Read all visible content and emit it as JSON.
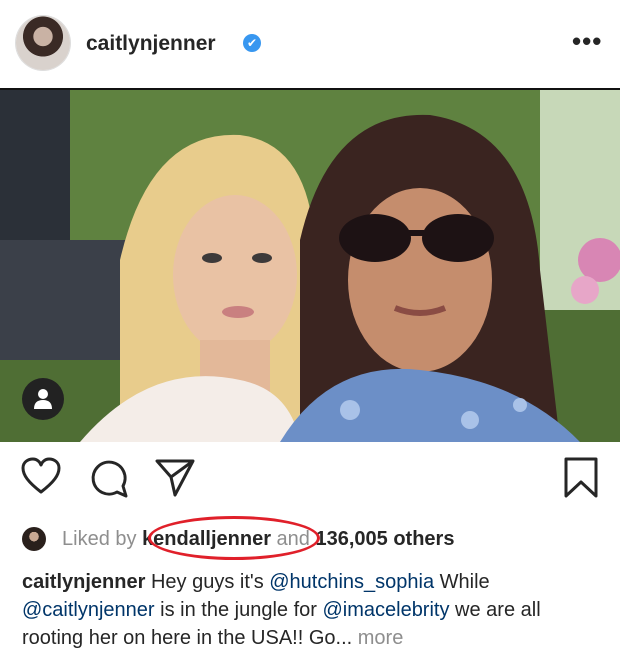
{
  "header": {
    "username": "caitlynjenner",
    "verified_mark": "✔",
    "more_label": "•••"
  },
  "actions": {
    "like_icon": "heart-icon",
    "comment_icon": "comment-icon",
    "share_icon": "send-icon",
    "save_icon": "bookmark-icon"
  },
  "likes": {
    "prefix": "Liked by ",
    "liker": "kendalljenner",
    "middle": " and ",
    "count": "136,005 others"
  },
  "caption": {
    "author": "caitlynjenner",
    "text_1": " Hey guys it's ",
    "mention_1": "@hutchins_sophia",
    "text_2": " While ",
    "mention_2": "@caitlynjenner",
    "text_3": " is in the jungle for ",
    "mention_3": "@imacelebrity",
    "text_4": " we are all rooting her on here in the USA!! Go...",
    "more": " more"
  },
  "colors": {
    "highlight_ring": "#e0202a",
    "verified": "#3897f0",
    "mention": "#003569",
    "muted": "#8e8e8e"
  }
}
